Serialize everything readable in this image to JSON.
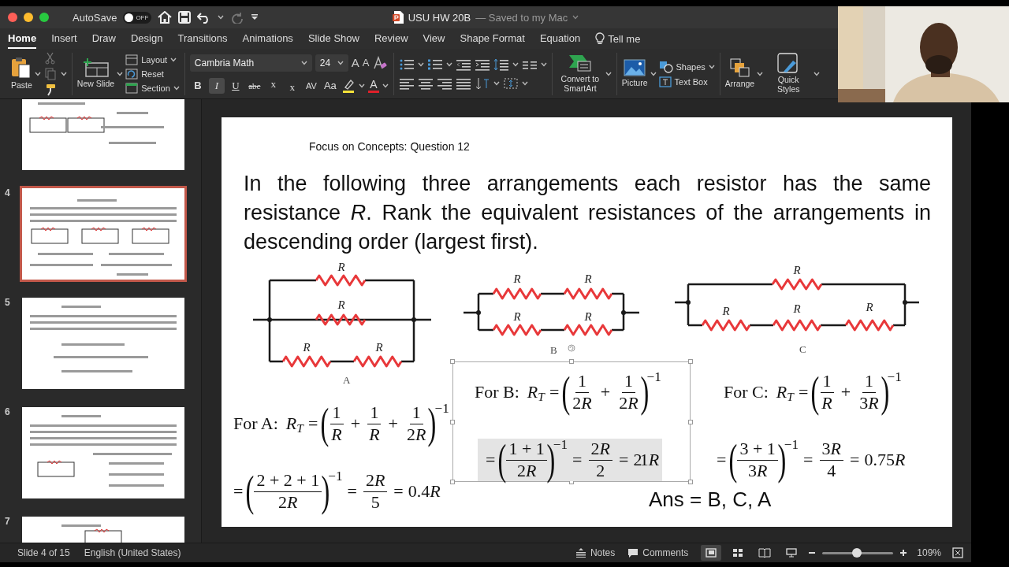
{
  "title_bar": {
    "autosave_label": "AutoSave",
    "autosave": {
      "on": false,
      "label": "OFF"
    },
    "document_title": "USU HW 20B",
    "save_status": "— Saved to my Mac"
  },
  "tabs": [
    {
      "label": "Home",
      "selected": true
    },
    {
      "label": "Insert",
      "selected": false
    },
    {
      "label": "Draw",
      "selected": false
    },
    {
      "label": "Design",
      "selected": false
    },
    {
      "label": "Transitions",
      "selected": false
    },
    {
      "label": "Animations",
      "selected": false
    },
    {
      "label": "Slide Show",
      "selected": false
    },
    {
      "label": "Review",
      "selected": false
    },
    {
      "label": "View",
      "selected": false
    },
    {
      "label": "Shape Format",
      "selected": false
    },
    {
      "label": "Equation",
      "selected": false
    }
  ],
  "tell_me": "Tell me",
  "ribbon": {
    "paste": "Paste",
    "new_slide": "New Slide",
    "slide_commands": [
      "Layout",
      "Reset",
      "Section"
    ],
    "font_name": "Cambria Math",
    "font_size": "24",
    "size_buttons": [
      {
        "text": "A",
        "kind": "grow"
      },
      {
        "text": "A",
        "kind": "shrink"
      }
    ],
    "format_buttons": [
      {
        "text": "B",
        "kind": "bold",
        "selected": false
      },
      {
        "text": "I",
        "kind": "italic",
        "selected": true
      },
      {
        "text": "U",
        "kind": "underline",
        "selected": false
      },
      {
        "text": "abc",
        "kind": "strike",
        "selected": false
      },
      {
        "text": "x",
        "kind": "superscript",
        "selected": false
      },
      {
        "text": "x",
        "kind": "subscript",
        "selected": false
      },
      {
        "text": "AV",
        "kind": "spacing",
        "selected": false
      },
      {
        "text": "Aa",
        "kind": "case",
        "selected": false
      }
    ],
    "font_color": "A",
    "smartart": "Convert to SmartArt",
    "picture": "Picture",
    "shapes": "Shapes",
    "text_box": "Text Box",
    "arrange": "Arrange",
    "quick_styles": "Quick Styles"
  },
  "thumbnails": [
    {
      "selected": false
    },
    {
      "number": "4",
      "selected": true
    },
    {
      "number": "5",
      "selected": false
    },
    {
      "number": "6",
      "selected": false
    },
    {
      "number": "7",
      "selected": false
    }
  ],
  "slide": {
    "heading": "Focus on Concepts: Question 12",
    "question": "In the following three arrangements each resistor has the same resistance *R*. Rank the equivalent resistances of the arrangements in descending order (largest first).",
    "circuits": [
      {
        "kind": "three-branch",
        "label": "A",
        "resistor_labels": [
          "R",
          "R",
          "R",
          "R"
        ]
      },
      {
        "kind": "two-by-two",
        "label": "B",
        "resistor_labels": [
          "R",
          "R",
          "R",
          "R"
        ]
      },
      {
        "kind": "one-over-three",
        "label": "C",
        "resistor_labels": [
          "R",
          "R",
          "R",
          "R"
        ]
      }
    ],
    "equation_groups": [
      {
        "selected": false,
        "lines": [
          {
            "highlighted": false,
            "tokens": [
              {
                "kind": "label",
                "text": "For A:"
              },
              {
                "kind": "var",
                "text": "R"
              },
              {
                "kind": "sub",
                "text": "T"
              },
              {
                "kind": "op",
                "text": "="
              },
              {
                "kind": "lp",
                "text": "("
              },
              {
                "kind": "frac",
                "num": [
                  {
                    "kind": "text",
                    "text": "1"
                  }
                ],
                "den": [
                  {
                    "kind": "var",
                    "text": "R"
                  }
                ]
              },
              {
                "kind": "op",
                "text": "+"
              },
              {
                "kind": "frac",
                "num": [
                  {
                    "kind": "text",
                    "text": "1"
                  }
                ],
                "den": [
                  {
                    "kind": "var",
                    "text": "R"
                  }
                ]
              },
              {
                "kind": "op",
                "text": "+"
              },
              {
                "kind": "frac",
                "num": [
                  {
                    "kind": "text",
                    "text": "1"
                  }
                ],
                "den": [
                  {
                    "kind": "text",
                    "text": "2"
                  },
                  {
                    "kind": "var",
                    "text": "R"
                  }
                ]
              },
              {
                "kind": "rp",
                "text": ")"
              },
              {
                "kind": "sup",
                "text": "−1"
              }
            ]
          },
          {
            "highlighted": false,
            "tokens": [
              {
                "kind": "op",
                "text": "="
              },
              {
                "kind": "lp",
                "text": "("
              },
              {
                "kind": "frac",
                "num": [
                  {
                    "kind": "text",
                    "text": "2 + 2 + 1"
                  }
                ],
                "den": [
                  {
                    "kind": "text",
                    "text": "2"
                  },
                  {
                    "kind": "var",
                    "text": "R"
                  }
                ]
              },
              {
                "kind": "rp",
                "text": ")"
              },
              {
                "kind": "sup",
                "text": "−1"
              },
              {
                "kind": "op",
                "text": "="
              },
              {
                "kind": "frac",
                "num": [
                  {
                    "kind": "text",
                    "text": "2"
                  },
                  {
                    "kind": "var",
                    "text": "R"
                  }
                ],
                "den": [
                  {
                    "kind": "text",
                    "text": "5"
                  }
                ]
              },
              {
                "kind": "op",
                "text": "="
              },
              {
                "kind": "text",
                "text": "0.4"
              },
              {
                "kind": "var",
                "text": "R"
              }
            ]
          }
        ]
      },
      {
        "selected": true,
        "lines": [
          {
            "highlighted": false,
            "tokens": [
              {
                "kind": "label",
                "text": "For B:"
              },
              {
                "kind": "var",
                "text": "R"
              },
              {
                "kind": "sub",
                "text": "T"
              },
              {
                "kind": "op",
                "text": "="
              },
              {
                "kind": "lp",
                "text": "("
              },
              {
                "kind": "frac",
                "num": [
                  {
                    "kind": "text",
                    "text": "1"
                  }
                ],
                "den": [
                  {
                    "kind": "text",
                    "text": "2"
                  },
                  {
                    "kind": "var",
                    "text": "R"
                  }
                ]
              },
              {
                "kind": "op",
                "text": "+"
              },
              {
                "kind": "frac",
                "num": [
                  {
                    "kind": "text",
                    "text": "1"
                  }
                ],
                "den": [
                  {
                    "kind": "text",
                    "text": "2"
                  },
                  {
                    "kind": "var",
                    "text": "R"
                  }
                ]
              },
              {
                "kind": "rp",
                "text": ")"
              },
              {
                "kind": "sup",
                "text": "−1"
              }
            ]
          },
          {
            "highlighted": true,
            "tokens": [
              {
                "kind": "op",
                "text": "="
              },
              {
                "kind": "lp",
                "text": "("
              },
              {
                "kind": "frac",
                "num": [
                  {
                    "kind": "text",
                    "text": "1 + 1"
                  }
                ],
                "den": [
                  {
                    "kind": "text",
                    "text": "2"
                  },
                  {
                    "kind": "var",
                    "text": "R"
                  }
                ]
              },
              {
                "kind": "rp",
                "text": ")"
              },
              {
                "kind": "sup",
                "text": "−1"
              },
              {
                "kind": "op",
                "text": "="
              },
              {
                "kind": "frac",
                "num": [
                  {
                    "kind": "text",
                    "text": "2"
                  },
                  {
                    "kind": "var",
                    "text": "R"
                  }
                ],
                "den": [
                  {
                    "kind": "text",
                    "text": "2"
                  }
                ]
              },
              {
                "kind": "op",
                "text": "="
              },
              {
                "kind": "text",
                "text": "2"
              },
              {
                "kind": "over",
                "text": "1"
              },
              {
                "kind": "var",
                "text": "R"
              }
            ]
          }
        ]
      },
      {
        "selected": false,
        "lines": [
          {
            "highlighted": false,
            "tokens": [
              {
                "kind": "label",
                "text": "For C:"
              },
              {
                "kind": "var",
                "text": "R"
              },
              {
                "kind": "sub",
                "text": "T"
              },
              {
                "kind": "op",
                "text": "="
              },
              {
                "kind": "lp",
                "text": "("
              },
              {
                "kind": "frac",
                "num": [
                  {
                    "kind": "text",
                    "text": "1"
                  }
                ],
                "den": [
                  {
                    "kind": "var",
                    "text": "R"
                  }
                ]
              },
              {
                "kind": "op",
                "text": "+"
              },
              {
                "kind": "frac",
                "num": [
                  {
                    "kind": "text",
                    "text": "1"
                  }
                ],
                "den": [
                  {
                    "kind": "text",
                    "text": "3"
                  },
                  {
                    "kind": "var",
                    "text": "R"
                  }
                ]
              },
              {
                "kind": "rp",
                "text": ")"
              },
              {
                "kind": "sup",
                "text": "−1"
              }
            ]
          },
          {
            "highlighted": false,
            "tokens": [
              {
                "kind": "op",
                "text": "="
              },
              {
                "kind": "lp",
                "text": "("
              },
              {
                "kind": "frac",
                "num": [
                  {
                    "kind": "text",
                    "text": "3 + 1"
                  }
                ],
                "den": [
                  {
                    "kind": "text",
                    "text": "3"
                  },
                  {
                    "kind": "var",
                    "text": "R"
                  }
                ]
              },
              {
                "kind": "rp",
                "text": ")"
              },
              {
                "kind": "sup",
                "text": "−1"
              },
              {
                "kind": "op",
                "text": "="
              },
              {
                "kind": "frac",
                "num": [
                  {
                    "kind": "text",
                    "text": "3"
                  },
                  {
                    "kind": "var",
                    "text": "R"
                  }
                ],
                "den": [
                  {
                    "kind": "text",
                    "text": "4"
                  }
                ]
              },
              {
                "kind": "op",
                "text": "="
              },
              {
                "kind": "text",
                "text": "0.75"
              },
              {
                "kind": "var",
                "text": "R"
              }
            ]
          }
        ]
      }
    ],
    "answer": "Ans = B, C, A"
  },
  "status_bar": {
    "slide_info": "Slide 4 of 15",
    "language": "English (United States)",
    "notes": "Notes",
    "comments": "Comments",
    "view_buttons": [
      {
        "kind": "normal",
        "selected": true
      },
      {
        "kind": "sorter",
        "selected": false
      },
      {
        "kind": "reading",
        "selected": false
      },
      {
        "kind": "slideshow",
        "selected": false
      }
    ],
    "zoom": {
      "level": 0.49,
      "reading": "109%"
    }
  }
}
